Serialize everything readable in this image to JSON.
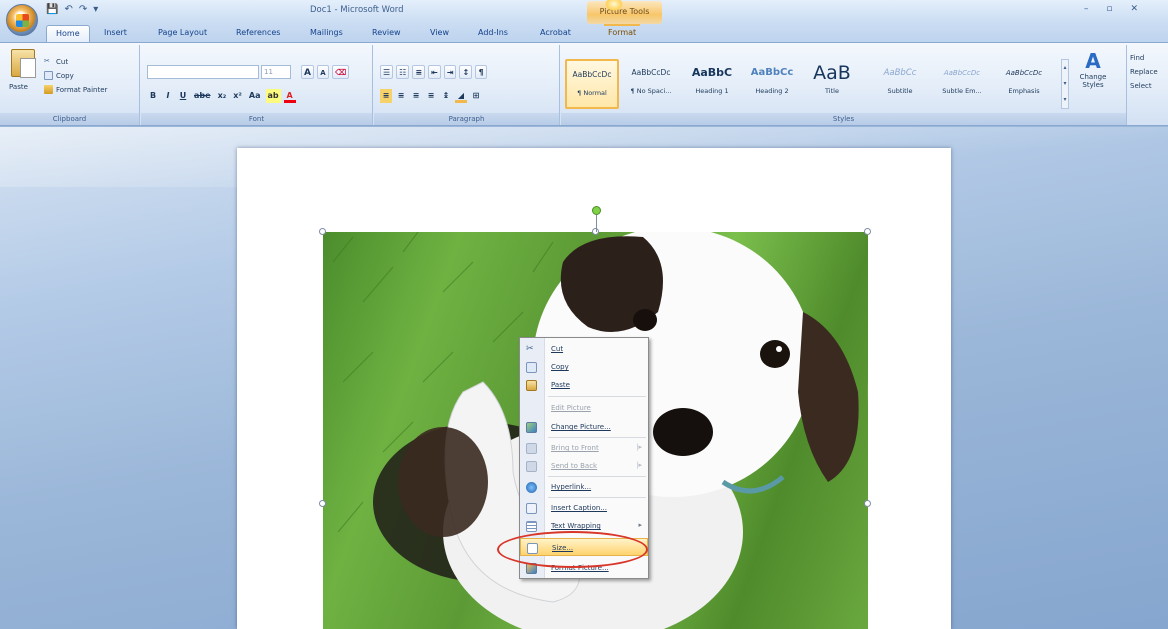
{
  "window": {
    "title": "Doc1 - Microsoft Word",
    "contextual_tools": "Picture Tools",
    "controls": [
      "–",
      "▫",
      "✕"
    ]
  },
  "tabs": [
    {
      "label": "Home",
      "active": true
    },
    {
      "label": "Insert"
    },
    {
      "label": "Page Layout"
    },
    {
      "label": "References"
    },
    {
      "label": "Mailings"
    },
    {
      "label": "Review"
    },
    {
      "label": "View"
    },
    {
      "label": "Add-Ins"
    },
    {
      "label": "Acrobat"
    },
    {
      "label": "Format",
      "contextual": true
    }
  ],
  "ribbon": {
    "clipboard": {
      "label": "Clipboard",
      "paste": "Paste",
      "cut": "Cut",
      "copy": "Copy",
      "format_painter": "Format Painter"
    },
    "font": {
      "label": "Font",
      "font_size": "11",
      "grow": "A",
      "shrink": "A",
      "buttons": [
        "B",
        "I",
        "U",
        "abe",
        "x₂",
        "x²",
        "Aa"
      ]
    },
    "paragraph": {
      "label": "Paragraph"
    },
    "styles": {
      "label": "Styles",
      "items": [
        {
          "sample": "AaBbCcDc",
          "name": "¶ Normal",
          "selected": true
        },
        {
          "sample": "AaBbCcDc",
          "name": "¶ No Spaci..."
        },
        {
          "sample": "AaBbC",
          "name": "Heading 1"
        },
        {
          "sample": "AaBbCc",
          "name": "Heading 2"
        },
        {
          "sample": "AaB",
          "name": "Title"
        },
        {
          "sample": "AaBbCc",
          "name": "Subtitle"
        },
        {
          "sample": "AaBbCcDc",
          "name": "Subtle Em..."
        },
        {
          "sample": "AaBbCcDc",
          "name": "Emphasis"
        }
      ],
      "change_styles": "Change Styles"
    },
    "editing": {
      "find": "Find",
      "replace": "Replace",
      "select": "Select"
    }
  },
  "context_menu": {
    "items": [
      {
        "label": "Cut",
        "icon": "scissors-icon"
      },
      {
        "label": "Copy",
        "icon": "copy-icon"
      },
      {
        "label": "Paste",
        "icon": "paste-icon"
      },
      {
        "label": "Edit Picture",
        "disabled": true
      },
      {
        "label": "Change Picture...",
        "icon": "change-picture-icon"
      },
      {
        "label": "Bring to Front",
        "disabled": true,
        "submenu": true,
        "icon": "bring-to-front-icon"
      },
      {
        "label": "Send to Back",
        "disabled": true,
        "submenu": true,
        "icon": "send-to-back-icon"
      },
      {
        "label": "Hyperlink...",
        "icon": "hyperlink-icon"
      },
      {
        "label": "Insert Caption...",
        "icon": "caption-icon"
      },
      {
        "label": "Text Wrapping",
        "submenu": true,
        "icon": "text-wrapping-icon"
      },
      {
        "label": "Size...",
        "highlighted": true,
        "icon": "size-icon"
      },
      {
        "label": "Format Picture...",
        "icon": "format-picture-icon"
      }
    ]
  },
  "colors": {
    "accent_highlight": "#ffd36e",
    "annotation_ring": "#d9362a",
    "ribbon_bg": "#e2ecf8"
  }
}
